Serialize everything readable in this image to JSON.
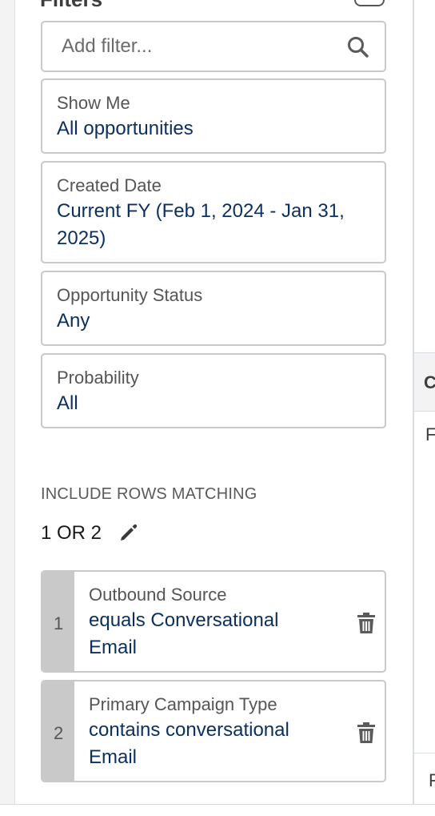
{
  "panel": {
    "title": "Filters",
    "search": {
      "placeholder": "Add filter...",
      "icon": "search-icon"
    },
    "filters": [
      {
        "label": "Show Me",
        "value": "All opportunities"
      },
      {
        "label": "Created Date",
        "value": "Current FY (Feb 1, 2024 - Jan 31, 2025)"
      },
      {
        "label": "Opportunity Status",
        "value": "Any"
      },
      {
        "label": "Probability",
        "value": "All"
      }
    ],
    "include_label": "INCLUDE ROWS MATCHING",
    "logic": "1 OR 2",
    "custom_filters": [
      {
        "num": "1",
        "field": "Outbound Source",
        "condition": "equals Conversational Email"
      },
      {
        "num": "2",
        "field": "Primary Campaign Type",
        "condition": "contains conversational Email"
      }
    ]
  },
  "right_column": {
    "header_fragment": "C",
    "cell_fragment_1": "F",
    "cell_fragment_2": "F"
  },
  "colors": {
    "value_text": "#0b2f5e",
    "label_text": "#555555",
    "border": "#c9c9c9"
  }
}
